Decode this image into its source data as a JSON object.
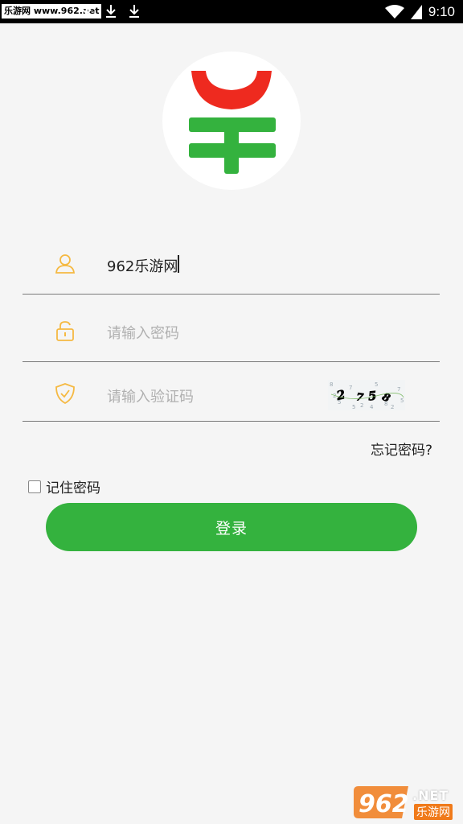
{
  "status_bar": {
    "watermark_text": "乐游网 www.962.net",
    "time": "9:10"
  },
  "form": {
    "username": {
      "value": "962乐游网",
      "icon": "user-icon"
    },
    "password": {
      "placeholder": "请输入密码",
      "icon": "unlock-icon"
    },
    "captcha": {
      "placeholder": "请输入验证码",
      "icon": "shield-check-icon",
      "code": "2758"
    }
  },
  "forgot_password": "忘记密码?",
  "remember_password": {
    "label": "记住密码",
    "checked": false
  },
  "login_button": "登录",
  "watermark": {
    "number": "962",
    "suffix": ".NET",
    "name": "乐游网"
  },
  "colors": {
    "accent_green": "#34b23e",
    "icon_orange": "#f5b942",
    "logo_red": "#ee2a1f"
  }
}
